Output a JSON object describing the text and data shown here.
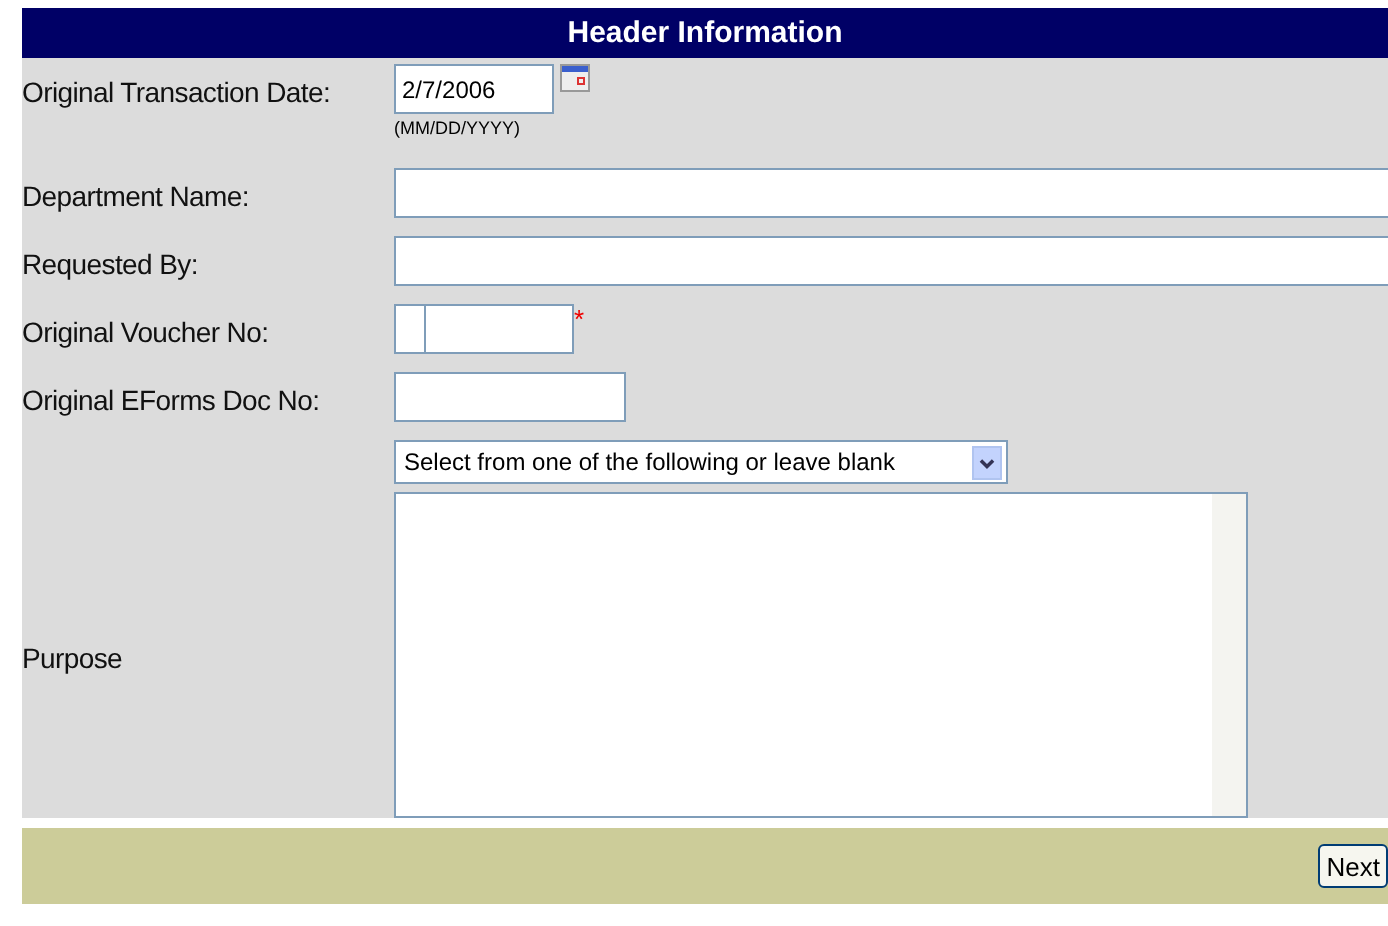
{
  "header": {
    "title": "Header Information"
  },
  "fields": [
    {
      "kind": "date",
      "label": "Original Transaction Date:",
      "value": "2/7/2006",
      "hint": "(MM/DD/YYYY)"
    },
    {
      "kind": "wide",
      "label": "Department Name:"
    },
    {
      "kind": "wide",
      "label": "Requested By:"
    },
    {
      "kind": "split",
      "label": "Original Voucher No:",
      "required_mark": "*"
    },
    {
      "kind": "medium",
      "label": "Original EForms Doc No:"
    }
  ],
  "purpose": {
    "label": "Purpose",
    "select": "Select from one of the following or leave blank"
  },
  "footer": {
    "button": "Next"
  }
}
